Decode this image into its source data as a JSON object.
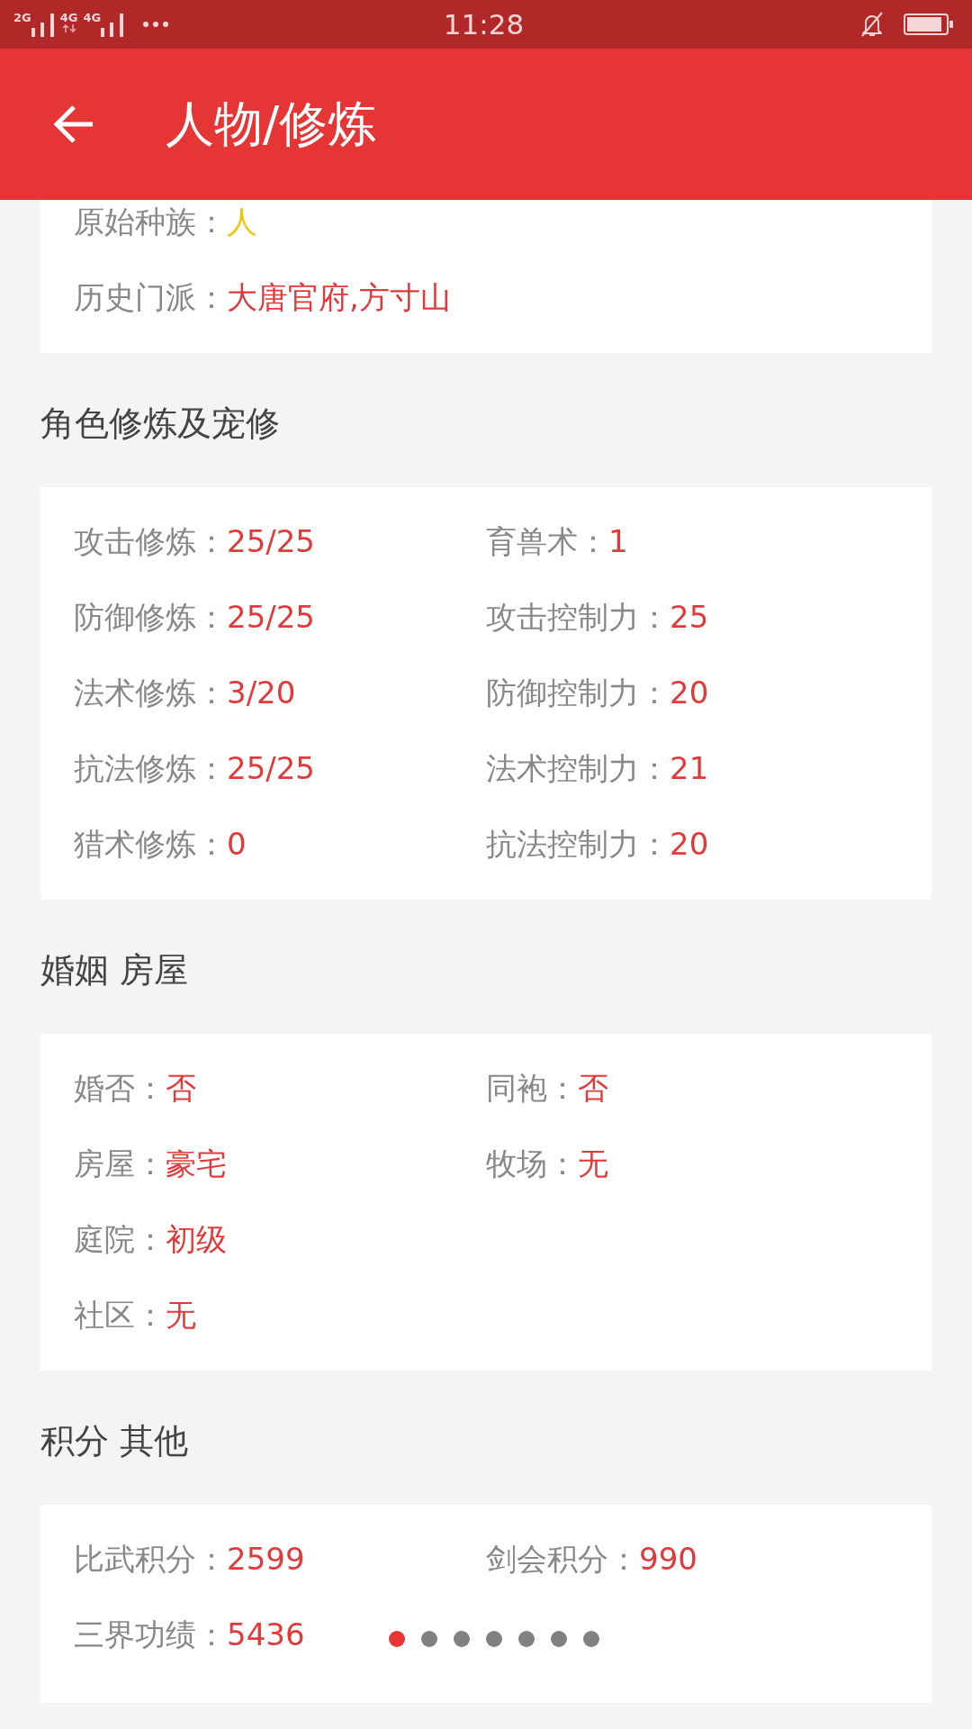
{
  "status_bar": {
    "network": [
      {
        "label": "2G",
        "kind": "signal"
      },
      {
        "label": "4G",
        "kind": "data"
      },
      {
        "label": "4G",
        "kind": "signal"
      }
    ],
    "time": "11:28"
  },
  "app_bar": {
    "title": "人物/修炼"
  },
  "sections": [
    {
      "rows": [
        [
          {
            "label": "原始种族：",
            "value": "人",
            "color": "#f2c40f"
          }
        ],
        [
          {
            "label": "历史门派：",
            "value": "大唐官府,方寸山",
            "color": "#e03a3a"
          }
        ]
      ]
    },
    {
      "title": "角色修炼及宠修",
      "rows": [
        [
          {
            "label": "攻击修炼：",
            "value": "25/25",
            "color": "#e03a3a"
          },
          {
            "label": "育兽术：",
            "value": "1",
            "color": "#e03a3a"
          }
        ],
        [
          {
            "label": "防御修炼：",
            "value": "25/25",
            "color": "#e03a3a"
          },
          {
            "label": "攻击控制力：",
            "value": "25",
            "color": "#e03a3a"
          }
        ],
        [
          {
            "label": "法术修炼：",
            "value": "3/20",
            "color": "#e03a3a"
          },
          {
            "label": "防御控制力：",
            "value": "20",
            "color": "#e03a3a"
          }
        ],
        [
          {
            "label": "抗法修炼：",
            "value": "25/25",
            "color": "#e03a3a"
          },
          {
            "label": "法术控制力：",
            "value": "21",
            "color": "#e03a3a"
          }
        ],
        [
          {
            "label": "猎术修炼：",
            "value": "0",
            "color": "#e03a3a"
          },
          {
            "label": "抗法控制力：",
            "value": "20",
            "color": "#e03a3a"
          }
        ]
      ]
    },
    {
      "title": "婚姻 房屋",
      "rows": [
        [
          {
            "label": "婚否：",
            "value": "否",
            "color": "#e03a3a"
          },
          {
            "label": "同袍：",
            "value": "否",
            "color": "#e03a3a"
          }
        ],
        [
          {
            "label": "房屋：",
            "value": "豪宅",
            "color": "#e03a3a"
          },
          {
            "label": "牧场：",
            "value": "无",
            "color": "#e03a3a"
          }
        ],
        [
          {
            "label": "庭院：",
            "value": "初级",
            "color": "#e03a3a"
          }
        ],
        [
          {
            "label": "社区：",
            "value": "无",
            "color": "#e03a3a"
          }
        ]
      ]
    },
    {
      "title": "积分 其他",
      "rows": [
        [
          {
            "label": "比武积分：",
            "value": "2599",
            "color": "#e03a3a"
          },
          {
            "label": "剑会积分：",
            "value": "990",
            "color": "#e03a3a"
          }
        ],
        [
          {
            "label": "三界功绩：",
            "value": "5436",
            "color": "#e03a3a"
          }
        ]
      ]
    }
  ],
  "pager_dots": [
    {
      "selected": true
    },
    {
      "selected": false
    },
    {
      "selected": false
    },
    {
      "selected": false
    },
    {
      "selected": false
    },
    {
      "selected": false
    },
    {
      "selected": false
    }
  ]
}
